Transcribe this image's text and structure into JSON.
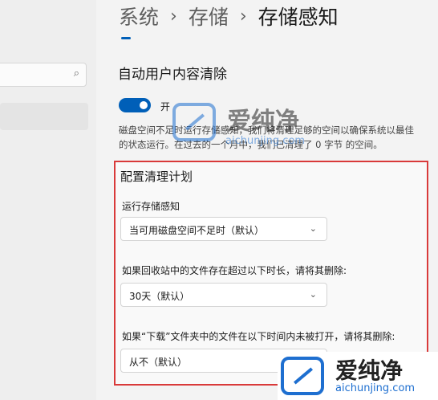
{
  "breadcrumb": {
    "items": [
      "系统",
      "存储",
      "存储感知"
    ],
    "separator": "›"
  },
  "section": {
    "title": "自动用户内容清除"
  },
  "toggle": {
    "state": "开",
    "on": true
  },
  "description": {
    "line1": "磁盘空间不足时运行存储感知，我们将清理足够的空间以确保系统以最佳",
    "line2": "的状态运行。在过去的一个月中，我们已清理了 0 字节 的空间。"
  },
  "schedule": {
    "title": "配置清理计划",
    "run_label": "运行存储感知",
    "run_value": "当可用磁盘空间不足时（默认）",
    "recycle_label": "如果回收站中的文件存在超过以下时长，请将其删除:",
    "recycle_value": "30天（默认）",
    "downloads_label": "如果“下载”文件夹中的文件在以下时间内未被打开，请将其删除:",
    "downloads_value": "从不（默认）"
  },
  "watermark": {
    "brand": "爱纯净",
    "url": "aichunjing.com"
  },
  "icons": {
    "search": "search-icon",
    "chevron": "chevron-down-icon"
  },
  "colors": {
    "accent": "#005fb8",
    "highlight_border": "#d93a3a",
    "watermark_blue": "#1e6fd0"
  }
}
